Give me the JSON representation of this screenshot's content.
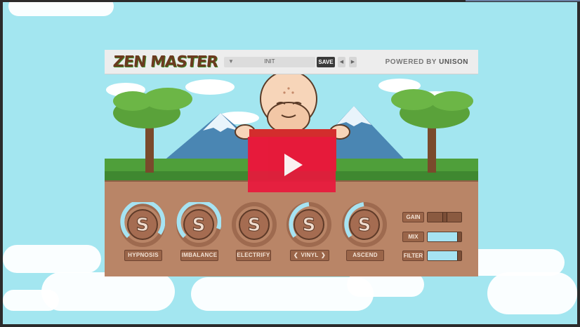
{
  "plugin": {
    "logo": "ZEN MASTER",
    "preset": {
      "name": "INIT",
      "save_label": "SAVE",
      "prev_icon": "triangle-left",
      "next_icon": "triangle-right",
      "dropdown_icon": "triangle-down"
    },
    "powered_by": "POWERED BY",
    "brand": "UNISON"
  },
  "knobs": [
    {
      "label": "HYPNOSIS",
      "level": 0.62
    },
    {
      "label": "IMBALANCE",
      "level": 0.7
    },
    {
      "label": "ELECTRIFY",
      "level": 0.0
    },
    {
      "label": "VINYL",
      "level": 0.5
    },
    {
      "label": "ASCEND",
      "level": 0.48
    }
  ],
  "vinyl_arrows": {
    "left": "❮",
    "right": "❯"
  },
  "sliders": [
    {
      "label": "GAIN",
      "level": 0.5
    },
    {
      "label": "MIX",
      "level": 0.92
    },
    {
      "label": "FILTER",
      "level": 0.92
    }
  ],
  "colors": {
    "sky": "#a3e6f0",
    "ground": "#b98567",
    "accent_cyan": "#a6e3f2",
    "play_red": "#e8193c"
  }
}
